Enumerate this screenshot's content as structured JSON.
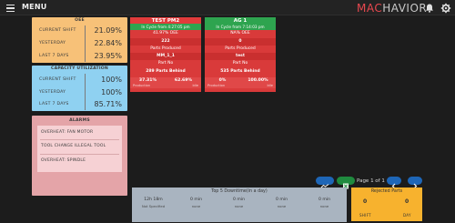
{
  "header": {
    "menu_label": "MENU",
    "logo_part1": "MAC",
    "logo_part2": "HAVIOR"
  },
  "oee": {
    "title": "OEE",
    "rows": [
      {
        "label": "CURRENT SHIFT",
        "value": "21.09%"
      },
      {
        "label": "YESTERDAY",
        "value": "22.84%"
      },
      {
        "label": "LAST 7 DAYS",
        "value": "23.95%"
      }
    ]
  },
  "capacity": {
    "title": "CAPACITY UTILIZATION",
    "rows": [
      {
        "label": "CURRENT SHIFT",
        "value": "100%"
      },
      {
        "label": "YESTERDAY",
        "value": "100%"
      },
      {
        "label": "LAST 7 DAYS",
        "value": "85.71%"
      }
    ]
  },
  "alarms": {
    "title": "ALARMS",
    "items": [
      "OVERHEAT: FAN MOTOR",
      "TOOL CHANGE ILLEGAL TOOL",
      "OVERHEAT: SPINDLE"
    ]
  },
  "machines": [
    {
      "name": "TEST PM2",
      "since": "In Cycle from 4:27:05 pm",
      "oee": "41.97% OEE",
      "parts_produced": "222",
      "parts_produced_label": "Parts Produced",
      "part_no": "MM_1_1",
      "part_no_label": "Part No",
      "parts_behind": "289 Parts Behind",
      "production": "37.31%",
      "production_label": "Production",
      "idle": "62.69%",
      "idle_label": "Idle"
    },
    {
      "name": "AG 1",
      "since": "In Cycle from 7:14:03 pm",
      "oee": "NA% OEE",
      "parts_produced": "0",
      "parts_produced_label": "Parts Produced",
      "part_no": "test",
      "part_no_label": "Part No",
      "parts_behind": "535 Parts Behind",
      "production": "0%",
      "production_label": "Production",
      "idle": "100.00%",
      "idle_label": "Idle"
    }
  ],
  "pager": {
    "text": "Page 1 of 1"
  },
  "downtime": {
    "title": "Top 5 Downtime(in a day)",
    "items": [
      {
        "value": "12h 18m",
        "name": "Not Specified"
      },
      {
        "value": "0 min",
        "name": "none"
      },
      {
        "value": "0 min",
        "name": "none"
      },
      {
        "value": "0 min",
        "name": "none"
      },
      {
        "value": "0 min",
        "name": "none"
      }
    ]
  },
  "rejected": {
    "title": "Rejected Parts",
    "shift_value": "0",
    "shift_label": "SHIFT",
    "day_value": "0",
    "day_label": "DAY"
  },
  "colors": {
    "oee": "#f7c178",
    "capacity": "#8fd1f1",
    "alarms": "#e4a4a8",
    "machine_red": "#d93a3a",
    "machine_header_green": "#2ea44f",
    "downtime": "#a9b4c0",
    "rejected": "#f7b22e",
    "brand": "#e8484f"
  }
}
